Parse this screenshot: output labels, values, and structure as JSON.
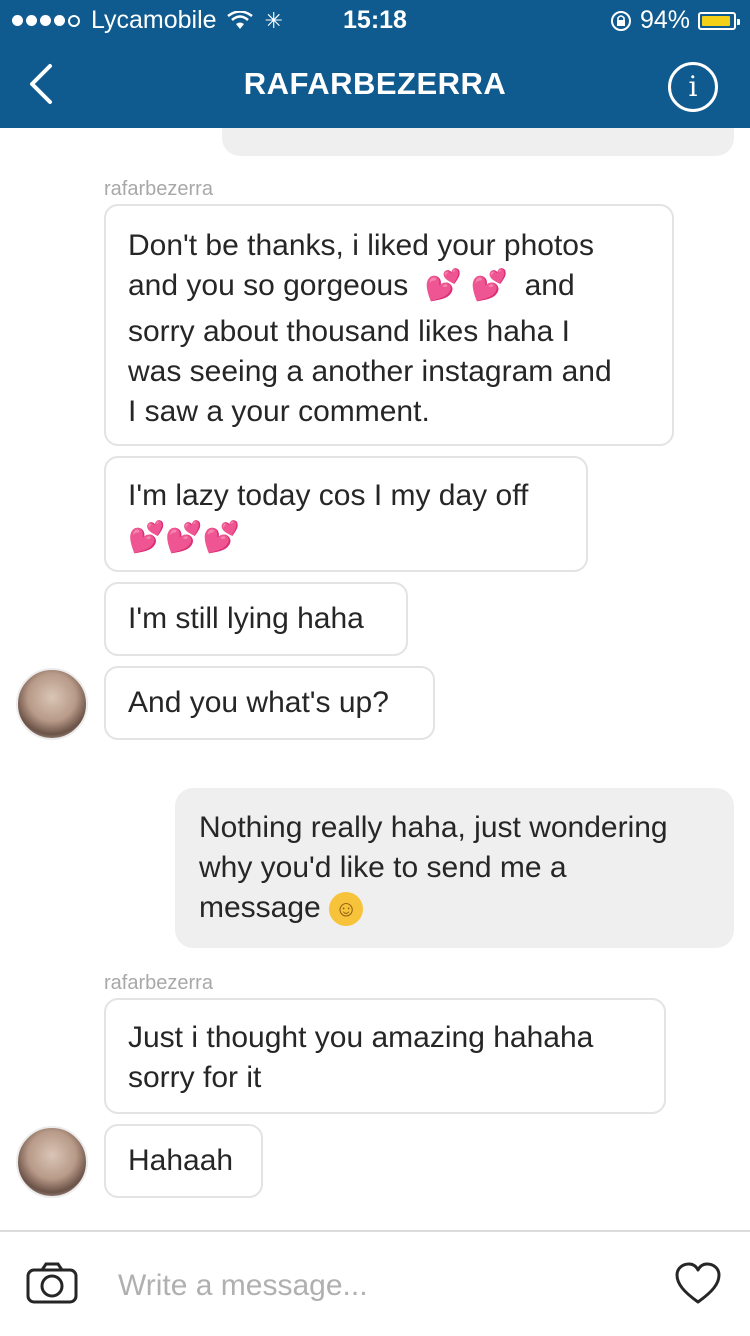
{
  "status_bar": {
    "carrier": "Lycamobile",
    "time": "15:18",
    "battery_percent": "94%",
    "battery_level": 0.94
  },
  "nav": {
    "title": "RAFARBEZERRA"
  },
  "messages": [
    {
      "sender": "rafarbezerra",
      "lines": [
        "Don't be thanks, i liked your photos",
        "and you so gorgeous",
        "and",
        "sorry about thousand likes haha I",
        "was seeing a another instagram and",
        "I saw a your comment."
      ]
    },
    {
      "text": "I'm lazy today cos I my day off"
    },
    {
      "text": "I'm still lying haha"
    },
    {
      "text": "And you what's up?"
    },
    {
      "lines": [
        "Nothing really haha, just wondering",
        "why you'd like to send me a",
        "message"
      ]
    },
    {
      "sender": "rafarbezerra",
      "lines": [
        "Just i thought you amazing  hahaha",
        "sorry for it"
      ]
    },
    {
      "text": "Hahaah"
    }
  ],
  "input": {
    "placeholder": "Write a message..."
  },
  "colors": {
    "header": "#0f5a8e",
    "incoming_bubble": "#ffffff",
    "outgoing_bubble": "#efefef",
    "heart_emoji": "#e8479a"
  }
}
